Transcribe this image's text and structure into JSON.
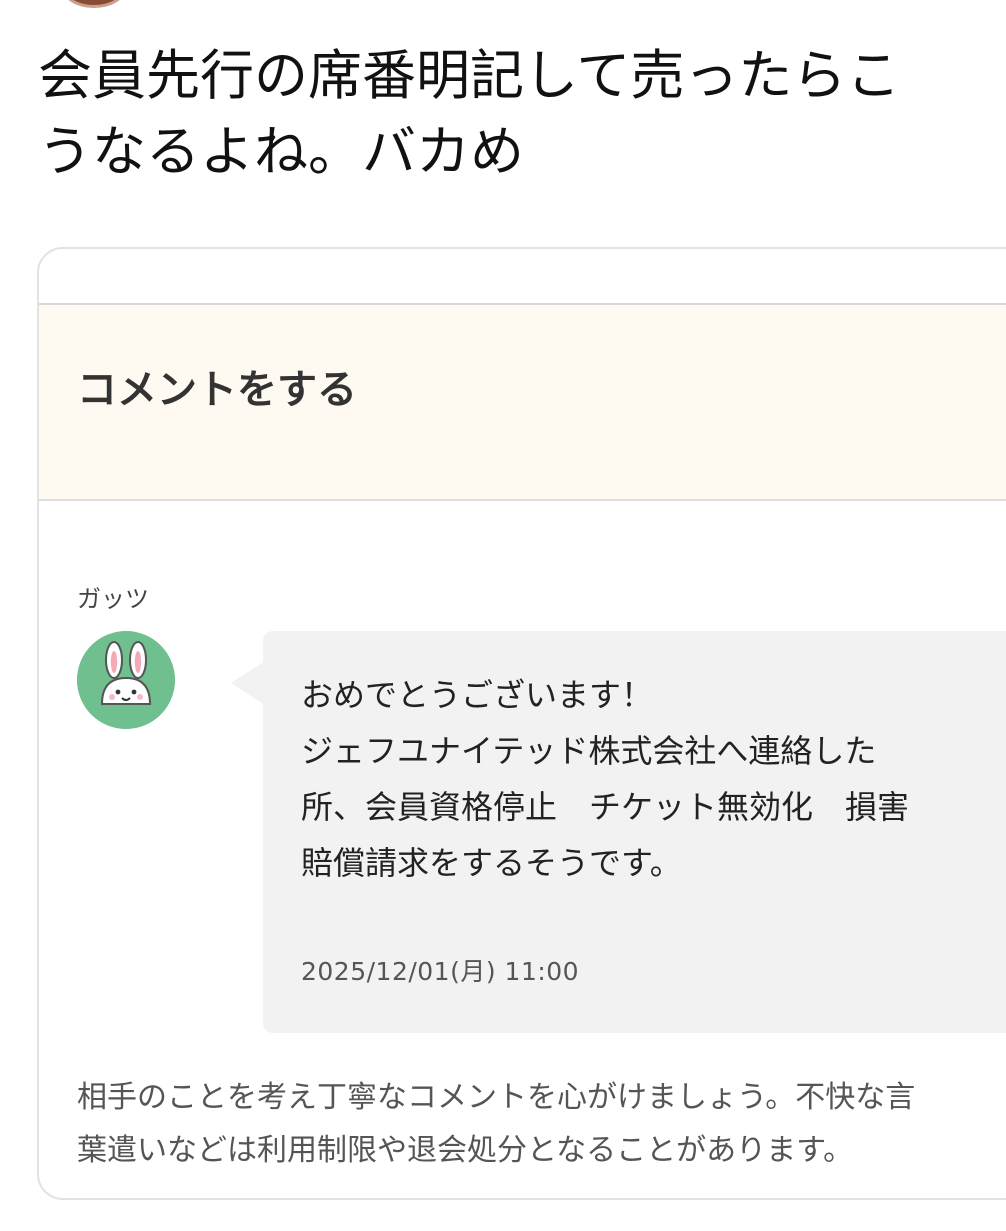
{
  "post": {
    "text": "会員先行の席番明記して売ったらこ\nうなるよね。バカめ"
  },
  "comment_card": {
    "title": "コメントをする",
    "comment": {
      "author": "ガッツ",
      "avatar_icon": "rabbit-icon",
      "body": "おめでとうございます！\nジェフユナイテッド株式会社へ連絡した\n所、会員資格停止　チケット無効化　損害\n賠償請求をするそうです。",
      "timestamp": "2025/12/01(月) 11:00"
    },
    "notice": "相手のことを考え丁寧なコメントを心がけましょう。不快な言\n葉遣いなどは利用制限や退会処分となることがあります。"
  },
  "colors": {
    "header_background": "#fffaf1",
    "bubble_background": "#f2f2f2",
    "avatar_background": "#6fbf8f"
  }
}
